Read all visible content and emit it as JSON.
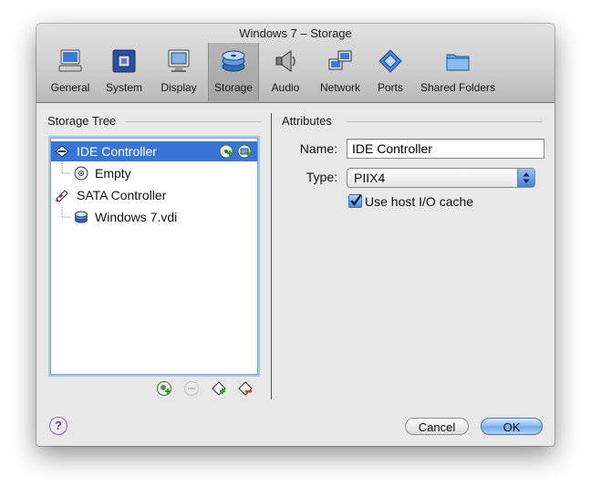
{
  "window": {
    "title": "Windows 7 – Storage"
  },
  "toolbar": {
    "items": [
      {
        "label": "General",
        "icon": "monitor-icon"
      },
      {
        "label": "System",
        "icon": "chip-icon"
      },
      {
        "label": "Display",
        "icon": "display-icon"
      },
      {
        "label": "Storage",
        "icon": "disk-stack-icon",
        "selected": true
      },
      {
        "label": "Audio",
        "icon": "speaker-icon"
      },
      {
        "label": "Network",
        "icon": "network-icon"
      },
      {
        "label": "Ports",
        "icon": "ports-icon"
      },
      {
        "label": "Shared Folders",
        "icon": "folder-icon"
      }
    ]
  },
  "storage_tree": {
    "heading": "Storage Tree",
    "items": [
      {
        "label": "IDE Controller",
        "icon": "ide-controller-icon",
        "selected": true
      },
      {
        "label": "Empty",
        "icon": "cd-icon"
      },
      {
        "label": "SATA Controller",
        "icon": "sata-controller-icon"
      },
      {
        "label": "Windows 7.vdi",
        "icon": "hard-disk-icon"
      }
    ],
    "buttons": [
      "add-controller-icon",
      "remove-controller-icon",
      "add-attachment-icon",
      "remove-attachment-icon"
    ]
  },
  "attributes": {
    "heading": "Attributes",
    "name_label": "Name:",
    "name_value": "IDE Controller",
    "type_label": "Type:",
    "type_value": "PIIX4",
    "cache_label": "Use host I/O cache",
    "cache_checked": true
  },
  "footer": {
    "help": "?",
    "cancel": "Cancel",
    "ok": "OK"
  },
  "colors": {
    "selection": "#3875d7",
    "default_button": "#6fa6e8"
  }
}
